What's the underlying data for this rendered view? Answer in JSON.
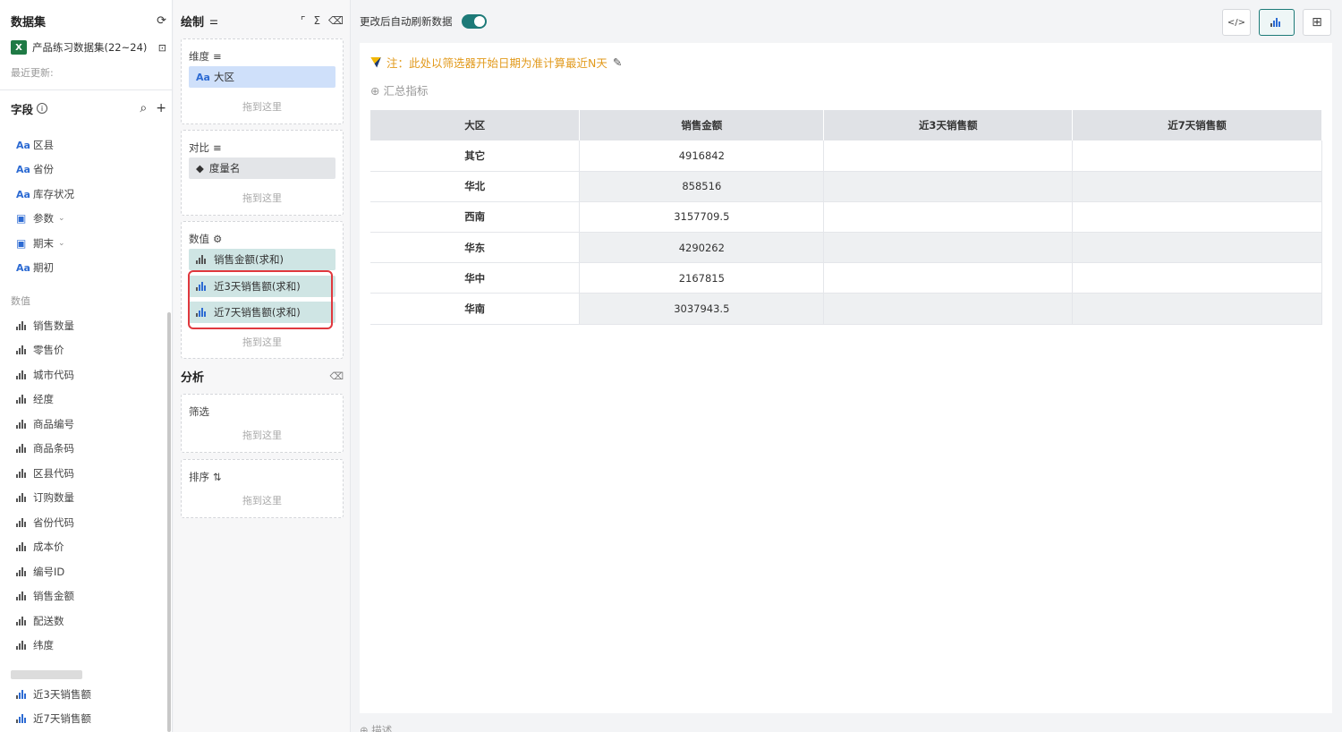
{
  "dataset": {
    "title": "数据集",
    "file_name": "产品练习数据集(22~24)",
    "updated_label": "最近更新:"
  },
  "fields": {
    "title": "字段",
    "dimensions": [
      {
        "icon": "Aa",
        "label": "区县"
      },
      {
        "icon": "Aa",
        "label": "省份"
      },
      {
        "icon": "Aa",
        "label": "库存状况"
      },
      {
        "icon": "calendar-icon",
        "label": "参数"
      },
      {
        "icon": "calendar-icon",
        "label": "期末"
      },
      {
        "icon": "Aa",
        "label": "期初"
      }
    ],
    "measures_label": "数值",
    "measures": [
      "销售数量",
      "零售价",
      "城市代码",
      "经度",
      "商品编号",
      "商品条码",
      "区县代码",
      "订购数量",
      "省份代码",
      "成本价",
      "编号ID",
      "销售金额",
      "配送数",
      "纬度"
    ],
    "calc_measures": [
      "近3天销售额",
      "近7天销售额"
    ]
  },
  "draw": {
    "title": "绘制",
    "dimension_label": "维度",
    "dimension_pill": "大区",
    "compare_label": "对比",
    "compare_pill": "度量名",
    "values_label": "数值",
    "value_pills": [
      "销售金额(求和)",
      "近3天销售额(求和)",
      "近7天销售额(求和)"
    ],
    "drop_hint": "拖到这里"
  },
  "analysis": {
    "title": "分析",
    "filter_label": "筛选",
    "sort_label": "排序",
    "drop_hint": "拖到这里"
  },
  "canvas": {
    "auto_refresh_label": "更改后自动刷新数据",
    "note": "注：此处以筛选器开始日期为准计算最近N天",
    "agg_label": "⊕ 汇总指标",
    "desc_label": "⊕ 描述",
    "table": {
      "headers": [
        "大区",
        "销售金额",
        "近3天销售额",
        "近7天销售额"
      ],
      "rows": [
        [
          "其它",
          "4916842",
          "",
          ""
        ],
        [
          "华北",
          "858516",
          "",
          ""
        ],
        [
          "西南",
          "3157709.5",
          "",
          ""
        ],
        [
          "华东",
          "4290262",
          "",
          ""
        ],
        [
          "华中",
          "2167815",
          "",
          ""
        ],
        [
          "华南",
          "3037943.5",
          "",
          ""
        ]
      ]
    }
  },
  "colors": {
    "accent": "#1d7a78",
    "highlight": "#e0383e",
    "note": "#e29a1c"
  }
}
